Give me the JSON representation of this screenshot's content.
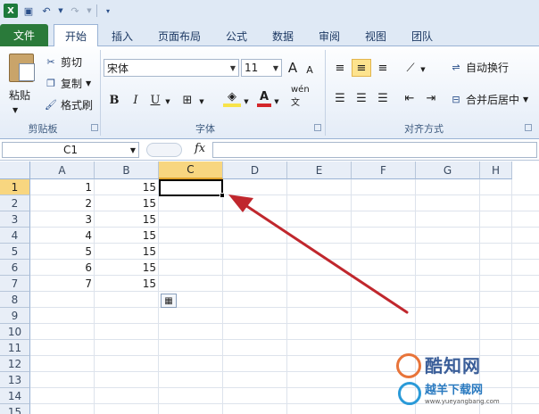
{
  "tabs": [
    {
      "label": "文件"
    },
    {
      "label": "开始"
    },
    {
      "label": "插入"
    },
    {
      "label": "页面布局"
    },
    {
      "label": "公式"
    },
    {
      "label": "数据"
    },
    {
      "label": "审阅"
    },
    {
      "label": "视图"
    },
    {
      "label": "团队"
    }
  ],
  "clipboard": {
    "paste": "粘贴",
    "cut": "剪切",
    "copy": "复制",
    "format_painter": "格式刷",
    "group": "剪贴板"
  },
  "font": {
    "name": "宋体",
    "size": "11",
    "bold": "B",
    "italic": "I",
    "underline": "U",
    "font_color_letter": "A",
    "phonetic": "wén 文",
    "grow": "A",
    "shrink": "A",
    "group": "字体"
  },
  "alignment": {
    "wrap_text": "自动换行",
    "merge_center": "合并后居中",
    "group": "对齐方式"
  },
  "formula_bar": {
    "name_box": "C1",
    "fx": "fx",
    "value": ""
  },
  "columns": [
    "A",
    "B",
    "C",
    "D",
    "E",
    "F",
    "G",
    "H"
  ],
  "rows": [
    "1",
    "2",
    "3",
    "4",
    "5",
    "6",
    "7",
    "8",
    "9",
    "10",
    "11",
    "12",
    "13",
    "14",
    "15"
  ],
  "cells": {
    "A": [
      "1",
      "2",
      "3",
      "4",
      "5",
      "6",
      "7"
    ],
    "B": [
      "15",
      "15",
      "15",
      "15",
      "15",
      "15",
      "15"
    ]
  },
  "active_cell": "C1",
  "watermark": {
    "name": "酷知网",
    "sub": "越羊下载网",
    "url": "www.yueyangbang.com"
  },
  "colors": {
    "file_tab": "#2a7a3a",
    "ribbon_bg": "#dfe9f5",
    "selected_header": "#f8d680",
    "arrow": "#c0272d"
  }
}
